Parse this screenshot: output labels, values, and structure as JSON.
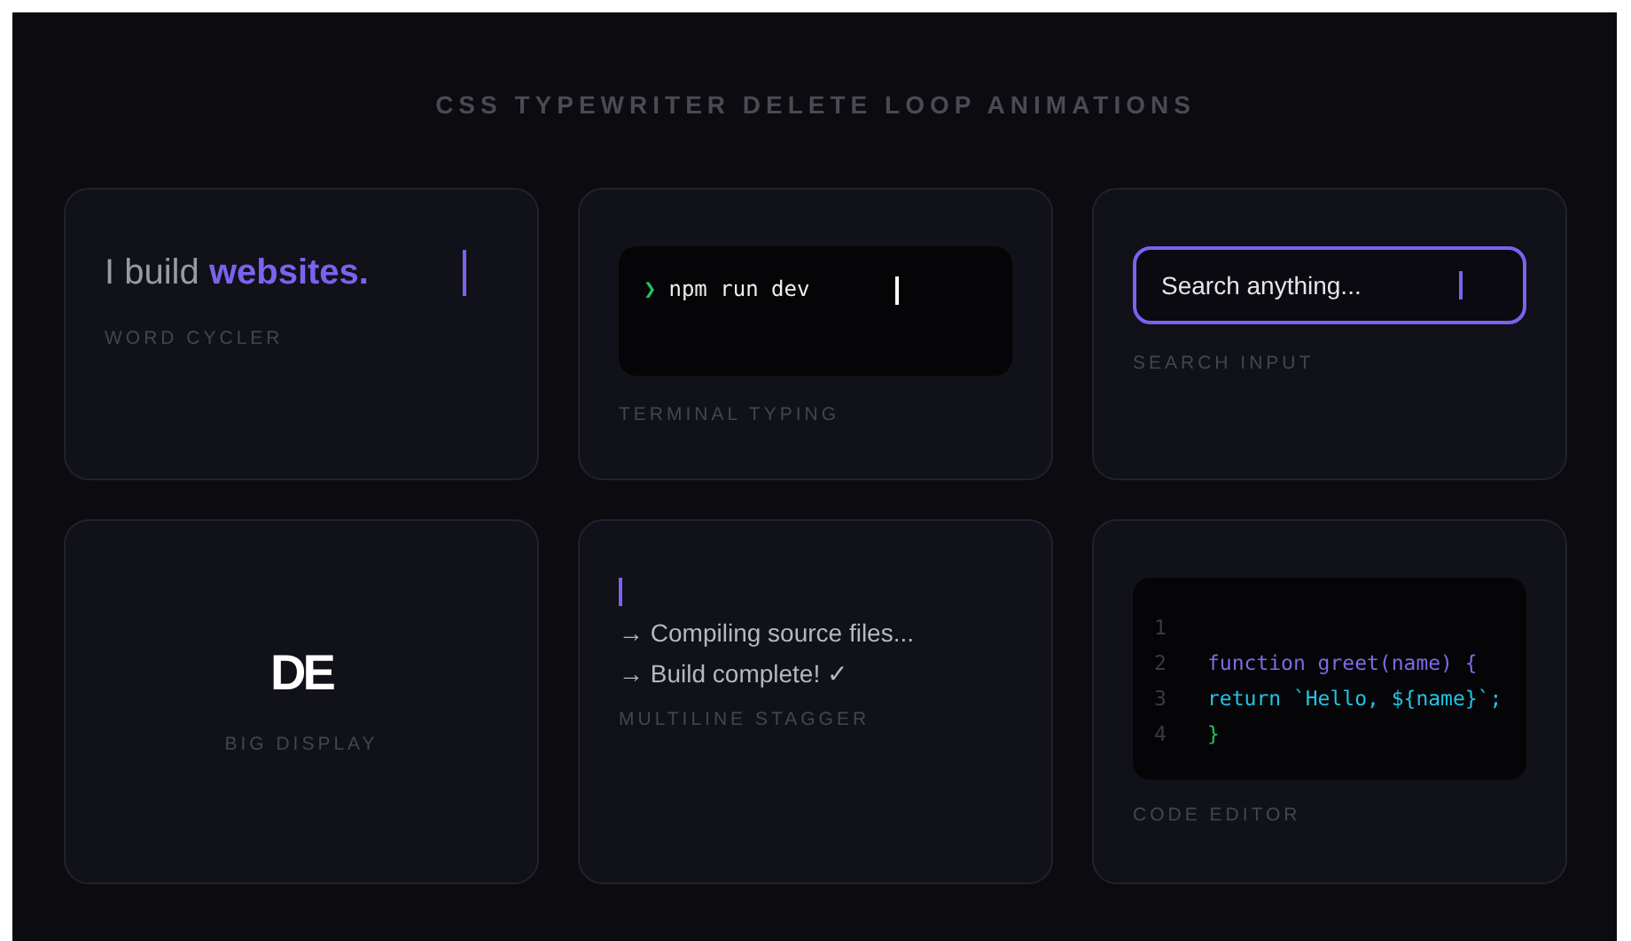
{
  "title": "CSS TYPEWRITER DELETE LOOP ANIMATIONS",
  "cards": [
    {
      "kind": "cycler",
      "prefix": "I build",
      "word": "websites.",
      "label": "WORD CYCLER"
    },
    {
      "kind": "terminal",
      "prompt": "❯",
      "command": "npm run dev",
      "label": "TERMINAL TYPING"
    },
    {
      "kind": "search",
      "placeholder": "Search anything...",
      "label": "SEARCH INPUT"
    },
    {
      "kind": "display",
      "text": "DE",
      "label": "BIG DISPLAY"
    },
    {
      "kind": "multiline",
      "lines": [
        "→ Compiling source files...",
        "→ Build complete! ✓"
      ],
      "label": "MULTILINE STAGGER"
    },
    {
      "kind": "code",
      "lines": [
        {
          "number": "1"
        },
        {
          "number": "2",
          "text": "function greet(name) {",
          "color": "#7c6ce6"
        },
        {
          "number": "3",
          "text": "return `Hello, ${name}`;",
          "color": "#22c3e6"
        },
        {
          "number": "4",
          "text": "}",
          "color": "#22c55e"
        }
      ],
      "label": "CODE EDITOR"
    }
  ]
}
